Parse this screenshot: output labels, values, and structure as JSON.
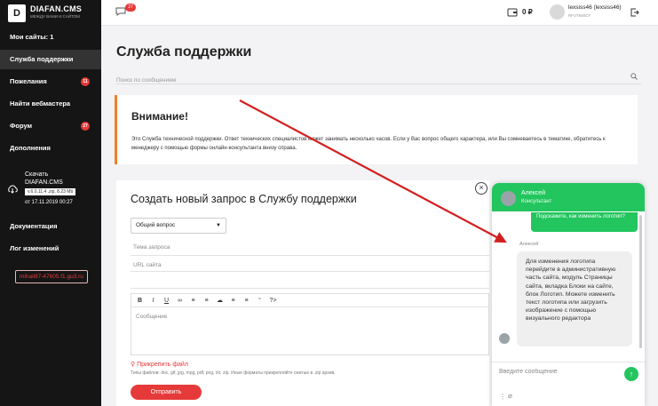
{
  "brand": {
    "logo_mark": "D",
    "name": "DIAFAN.CMS",
    "subtitle": "МЕЖДУ ВАМИ И САЙТОМ"
  },
  "sidebar": {
    "items": [
      {
        "label": "Мои сайты: 1"
      },
      {
        "label": "Служба поддержки",
        "active": true
      },
      {
        "label": "Пожелания",
        "badge": "11"
      },
      {
        "label": "Найти вебмастера"
      },
      {
        "label": "Форум",
        "badge": "27"
      },
      {
        "label": "Дополнения"
      },
      {
        "label": "Документация"
      },
      {
        "label": "Лог изменений"
      }
    ],
    "download": {
      "title": "Скачать DIAFAN.CMS",
      "version": "v.6.0.11.4 .zip, 8.23 Mb",
      "date": "от 17.11.2019 00:27"
    }
  },
  "topbar": {
    "chat_badge": "27",
    "balance": "0 ₽",
    "user_name": "lexsiss46 (lexsiss46)",
    "user_id": "RFVT680CF"
  },
  "page": {
    "title": "Служба поддержки",
    "search_placeholder": "Поиск по сообщениям"
  },
  "notice": {
    "title": "Внимание!",
    "text": "Это Служба технической поддержки. Ответ технических специалистов может занимать несколько часов. Если у Вас вопрос общего характера, или Вы сомневаетесь в тематике, обратитесь к менеджеру с помощью формы онлайн-консультанта внизу справа."
  },
  "new_request": {
    "title": "Создать новый запрос в Службу поддержки",
    "category": "Общий вопрос",
    "topic_label": "Тема запроса",
    "url_label": "URL сайта",
    "url_value": "mihail87-47605.f1.gu3.ru",
    "message_placeholder": "Сообщение",
    "toolbar": [
      "B",
      "I",
      "U",
      "∞",
      "≡",
      "≡",
      "☁",
      "≡",
      "≡",
      "“",
      "?>"
    ],
    "attach_label": "Прикрепить файл",
    "attach_hint": "Типы файлов: doc, gif, jpg, mpg, pdf, png, txt, zip. Иные форматы прикрепляйте сжатые в .zip архив.",
    "send_label": "Отправить"
  },
  "chat": {
    "operator_name": "Алексей",
    "operator_role": "Консультант",
    "user_message": "Подскажите, как изменить логотип?",
    "sender": "Алексей",
    "reply": "Для изменения логотипа перейдите в административную часть сайта, модуль Страницы сайта, вкладка Блоки на сайте, блок Логотип. Можете изменить текст логотипа или загрузить изображение с помощью визуального редактора",
    "input_placeholder": "Введите сообщение",
    "send_icon": "↑"
  },
  "colors": {
    "accent": "#e63a3a",
    "chat_green": "#22c55e",
    "notice_border": "#f07f2a",
    "arrow": "#d41f1f"
  }
}
